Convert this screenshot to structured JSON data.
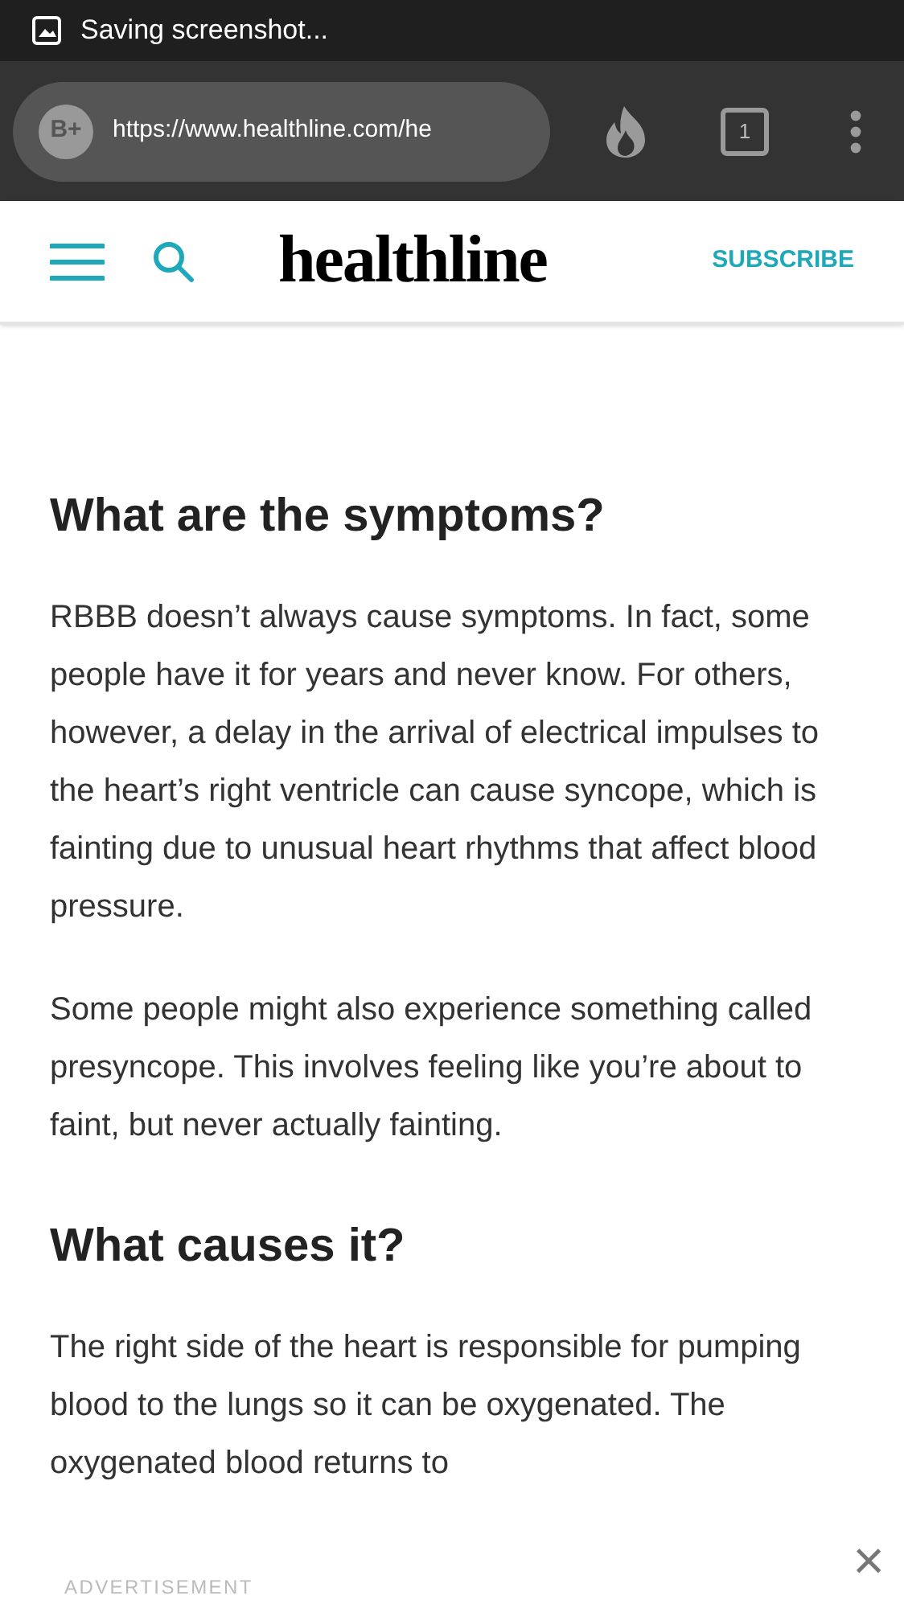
{
  "status_bar": {
    "notification": "Saving screenshot..."
  },
  "browser": {
    "url": "https://www.healthline.com/he",
    "profile_badge": "B+",
    "tab_count": "1"
  },
  "site_header": {
    "logo": "healthline",
    "subscribe": "SUBSCRIBE"
  },
  "article": [
    {
      "kind": "heading",
      "text": "What are the symptoms?"
    },
    {
      "kind": "paragraph",
      "text": "RBBB doesn’t always cause symptoms. In fact, some people have it for years and never know. For others, however, a delay in the arrival of electrical impulses to the heart’s right ventricle can cause syncope, which is fainting due to unusual heart rhythms that affect blood pressure."
    },
    {
      "kind": "paragraph",
      "text": "Some people might also experience something called presyncope. This involves feeling like you’re about to faint, but never actually fainting."
    },
    {
      "kind": "heading",
      "text": "What causes it?"
    },
    {
      "kind": "paragraph",
      "text": "The right side of the heart is responsible for pumping blood to the lungs so it can be oxygenated. The oxygenated blood returns to"
    }
  ],
  "ad_bar": {
    "label": "ADVERTISEMENT",
    "close": "×"
  }
}
